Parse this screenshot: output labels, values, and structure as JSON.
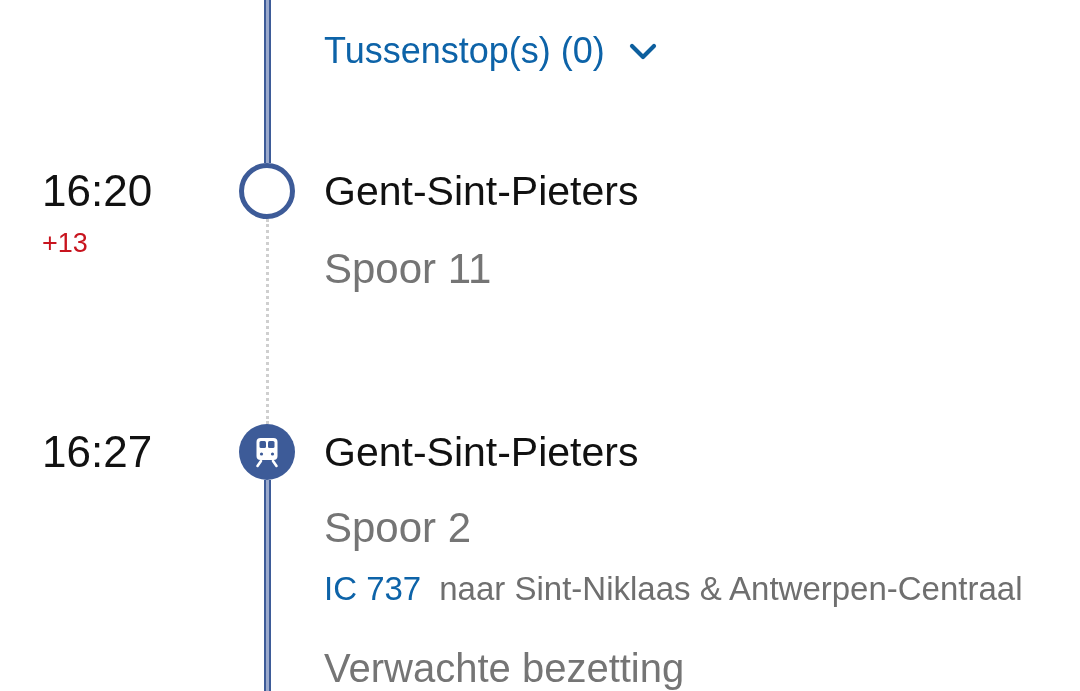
{
  "leg_above": {
    "intermediate_stops": {
      "label": "Tussenstop(s) (0)",
      "expanded": false
    }
  },
  "stops": [
    {
      "kind": "arrival",
      "time": "16:20",
      "delay": "+13",
      "station": "Gent-Sint-Pieters",
      "platform": "Spoor 11",
      "transfer_after": true
    },
    {
      "kind": "departure",
      "time": "16:27",
      "station": "Gent-Sint-Pieters",
      "platform": "Spoor 2",
      "train": {
        "number": "IC 737",
        "direction": "naar Sint-Niklaas & Antwerpen-Centraal"
      },
      "occupancy_label": "Verwachte bezetting",
      "transfer_after": false
    }
  ]
}
